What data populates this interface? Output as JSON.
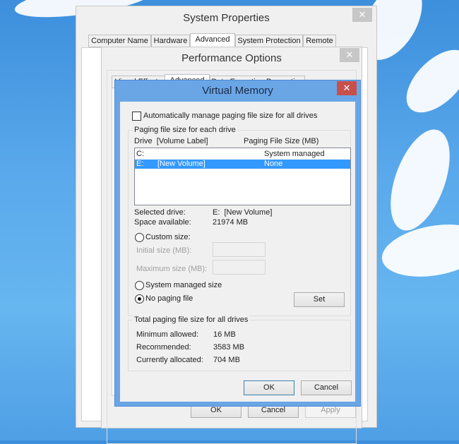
{
  "system_properties": {
    "title": "System Properties",
    "close": "✕",
    "tabs": [
      "Computer Name",
      "Hardware",
      "Advanced",
      "System Protection",
      "Remote"
    ],
    "selected_tab": "Advanced"
  },
  "performance_options": {
    "title": "Performance Options",
    "close": "✕",
    "tabs": [
      "Visual Effects",
      "Advanced",
      "Data Execution Prevention"
    ],
    "buttons": {
      "ok": "OK",
      "cancel": "Cancel",
      "apply": "Apply"
    }
  },
  "virtual_memory": {
    "title": "Virtual Memory",
    "close": "✕",
    "auto_manage_label": "Automatically manage paging file size for all drives",
    "auto_manage_checked": false,
    "per_drive_group": "Paging file size for each drive",
    "col_drive": "Drive  [Volume Label]",
    "col_size": "Paging File Size (MB)",
    "drives": [
      {
        "drive": "C:",
        "label": "",
        "size": "System managed"
      },
      {
        "drive": "E:",
        "label": "[New Volume]",
        "size": "None",
        "selected": true
      }
    ],
    "selected_drive_label": "Selected drive:",
    "selected_drive_value": "E:  [New Volume]",
    "space_label": "Space available:",
    "space_value": "21974 MB",
    "custom_size": "Custom size:",
    "initial_size": "Initial size (MB):",
    "maximum_size": "Maximum size (MB):",
    "system_managed": "System managed size",
    "no_paging": "No paging file",
    "selected_option": "No paging file",
    "set": "Set",
    "total_group": "Total paging file size for all drives",
    "min_label": "Minimum allowed:",
    "min_value": "16 MB",
    "rec_label": "Recommended:",
    "rec_value": "3583 MB",
    "cur_label": "Currently allocated:",
    "cur_value": "704 MB",
    "ok": "OK",
    "cancel": "Cancel"
  },
  "colors": {
    "vm_frame": "#6aa6e6",
    "close_red": "#c7504b",
    "selection": "#3399ff"
  }
}
